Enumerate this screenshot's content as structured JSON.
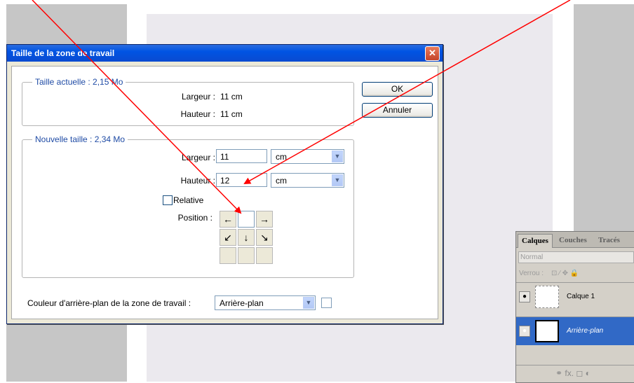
{
  "dialog": {
    "title": "Taille de la zone de travail",
    "close_label": "✕",
    "current": {
      "legend": "Taille actuelle : 2,15 Mo",
      "width_label": "Largeur :",
      "width_value": "11 cm",
      "height_label": "Hauteur :",
      "height_value": "11 cm"
    },
    "new": {
      "legend": "Nouvelle taille : 2,34 Mo",
      "width_label": "Largeur :",
      "width_value": "11",
      "width_unit": "cm",
      "height_label": "Hauteur :",
      "height_value": "12",
      "height_unit": "cm",
      "relative_label": "Relative",
      "position_label": "Position :"
    },
    "ok_label": "OK",
    "cancel_label": "Annuler",
    "bg_label": "Couleur d'arrière-plan de la zone de travail :",
    "bg_value": "Arrière-plan"
  },
  "anchor_grid": {
    "arrows": [
      "←",
      "",
      "→",
      "↙",
      "↓",
      "↘",
      "",
      "",
      ""
    ]
  },
  "layers_panel": {
    "tabs": [
      "Calques",
      "Couches",
      "Tracés"
    ],
    "blend_mode": "Normal",
    "lock_label": "Verrou :",
    "layers": [
      {
        "name": "Calque 1",
        "selected": false
      },
      {
        "name": "Arrière-plan",
        "selected": true
      }
    ],
    "footer_icons": "⚭  fx.  ◻  ◐"
  },
  "colors": {
    "title_bar": "#0054e3",
    "selected_layer": "#3169c6",
    "annotation_arrow": "#ff0000"
  }
}
